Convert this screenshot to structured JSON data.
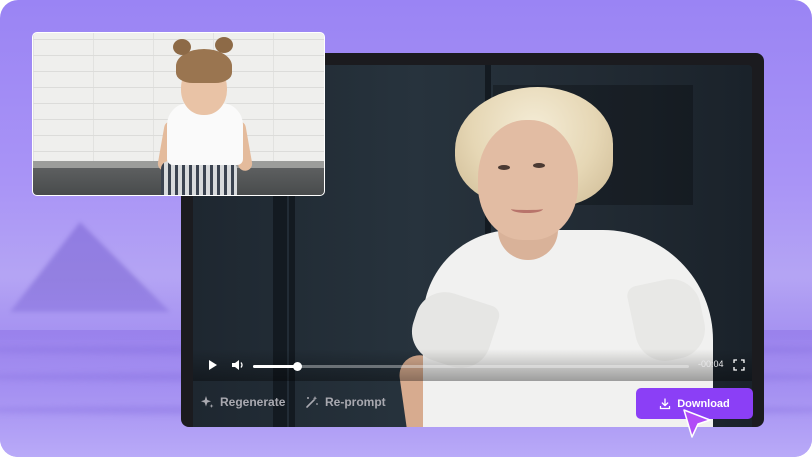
{
  "player": {
    "time_remaining": "-00:04",
    "progress": 0.1
  },
  "actions": {
    "regenerate_label": "Regenerate",
    "reprompt_label": "Re-prompt",
    "download_label": "Download"
  },
  "colors": {
    "accent": "#8b3ff6",
    "player_bg": "#1b1b1f",
    "background": "#9a84f4"
  },
  "icons": {
    "play": "play-icon",
    "volume": "volume-icon",
    "fullscreen": "fullscreen-icon",
    "regenerate": "sparkle-icon",
    "reprompt": "magic-wand-icon",
    "download": "download-icon",
    "cursor": "cursor-arrow-icon"
  }
}
